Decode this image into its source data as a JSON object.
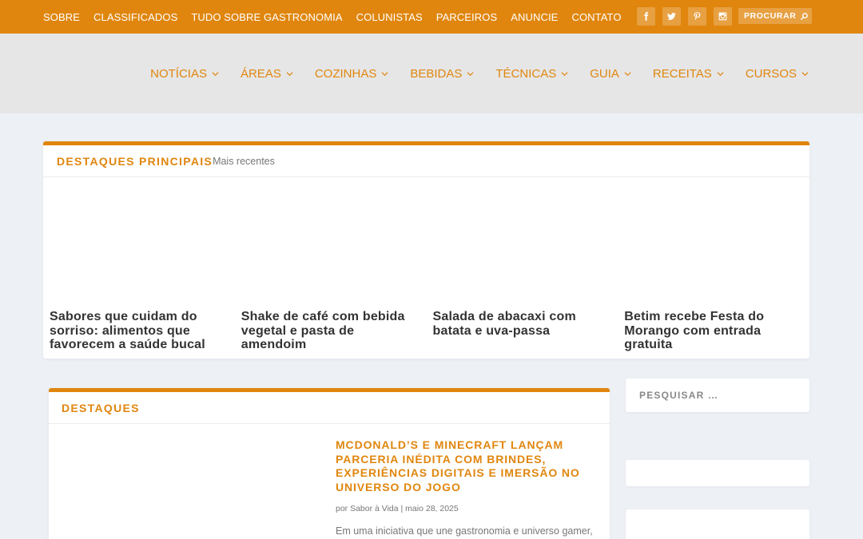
{
  "topbar": {
    "links": [
      "SOBRE",
      "CLASSIFICADOS",
      "TUDO SOBRE GASTRONOMIA",
      "COLUNISTAS",
      "PARCEIROS",
      "ANUNCIE",
      "CONTATO"
    ],
    "search_label": "PROCURAR",
    "social_icons": [
      "facebook-icon",
      "twitter-icon",
      "pinterest-icon",
      "instagram-icon"
    ]
  },
  "mainnav": {
    "items": [
      "NOTÍCIAS",
      "ÁREAS",
      "COZINHAS",
      "BEBIDAS",
      "TÉCNICAS",
      "GUIA",
      "RECEITAS",
      "CURSOS"
    ]
  },
  "featured": {
    "title": "DESTAQUES PRINCIPAIS",
    "subtitle": "Mais recentes",
    "posts": [
      {
        "title": "Sabores que cuidam do sorriso: alimentos que favorecem a saúde bucal"
      },
      {
        "title": "Shake de café com bebida vegetal e pasta de amendoim"
      },
      {
        "title": "Salada de abacaxi com batata e uva-passa"
      },
      {
        "title": "Betim recebe Festa do Morango com entrada gratuita"
      }
    ]
  },
  "destaques": {
    "title": "DESTAQUES",
    "article": {
      "title": "MCDONALD’S E MINECRAFT LANÇAM PARCERIA INÉDITA COM BRINDES, EXPERIÊNCIAS DIGITAIS E IMERSÃO NO UNIVERSO DO JOGO",
      "meta": "por Sabor à Vida | maio 28, 2025",
      "excerpt": "Em uma iniciativa que une gastronomia e universo gamer,"
    }
  },
  "sidebar": {
    "search_placeholder": "PESQUISAR …"
  },
  "colors": {
    "accent": "#e0860e",
    "header_bg": "#e6e6e6",
    "page_bg": "#edf0f5"
  }
}
